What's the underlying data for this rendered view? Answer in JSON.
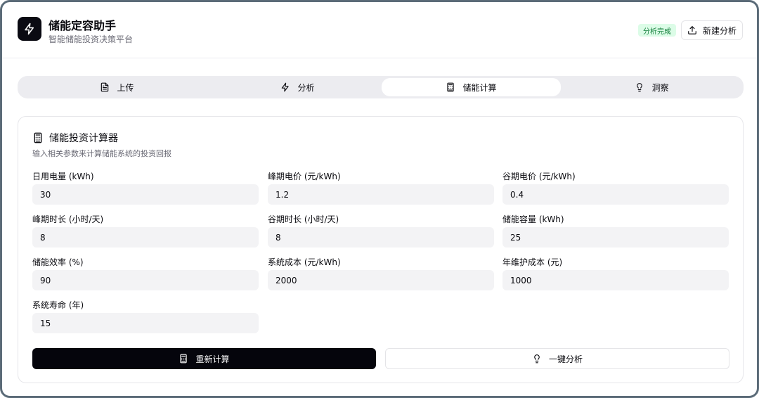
{
  "header": {
    "app_title": "储能定容助手",
    "app_subtitle": "智能储能投资决策平台",
    "status_badge": "分析完成",
    "new_analysis_label": "新建分析"
  },
  "tabs": [
    {
      "label": "上传",
      "icon": "file-text-icon",
      "active": false
    },
    {
      "label": "分析",
      "icon": "zap-icon",
      "active": false
    },
    {
      "label": "储能计算",
      "icon": "calculator-icon",
      "active": true
    },
    {
      "label": "洞察",
      "icon": "lightbulb-icon",
      "active": false
    }
  ],
  "calculator": {
    "title": "储能投资计算器",
    "description": "输入相关参数来计算储能系统的投资回报",
    "fields": [
      {
        "label": "日用电量 (kWh)",
        "value": "30"
      },
      {
        "label": "峰期电价 (元/kWh)",
        "value": "1.2"
      },
      {
        "label": "谷期电价 (元/kWh)",
        "value": "0.4"
      },
      {
        "label": "峰期时长 (小时/天)",
        "value": "8"
      },
      {
        "label": "谷期时长 (小时/天)",
        "value": "8"
      },
      {
        "label": "储能容量 (kWh)",
        "value": "25"
      },
      {
        "label": "储能效率 (%)",
        "value": "90"
      },
      {
        "label": "系统成本 (元/kWh)",
        "value": "2000"
      },
      {
        "label": "年维护成本 (元)",
        "value": "1000"
      },
      {
        "label": "系统寿命 (年)",
        "value": "15"
      }
    ],
    "recalculate_label": "重新计算",
    "one_click_label": "一键分析"
  },
  "colors": {
    "badge_bg": "#dcfce7",
    "badge_text": "#15803d",
    "primary": "#05050c"
  }
}
